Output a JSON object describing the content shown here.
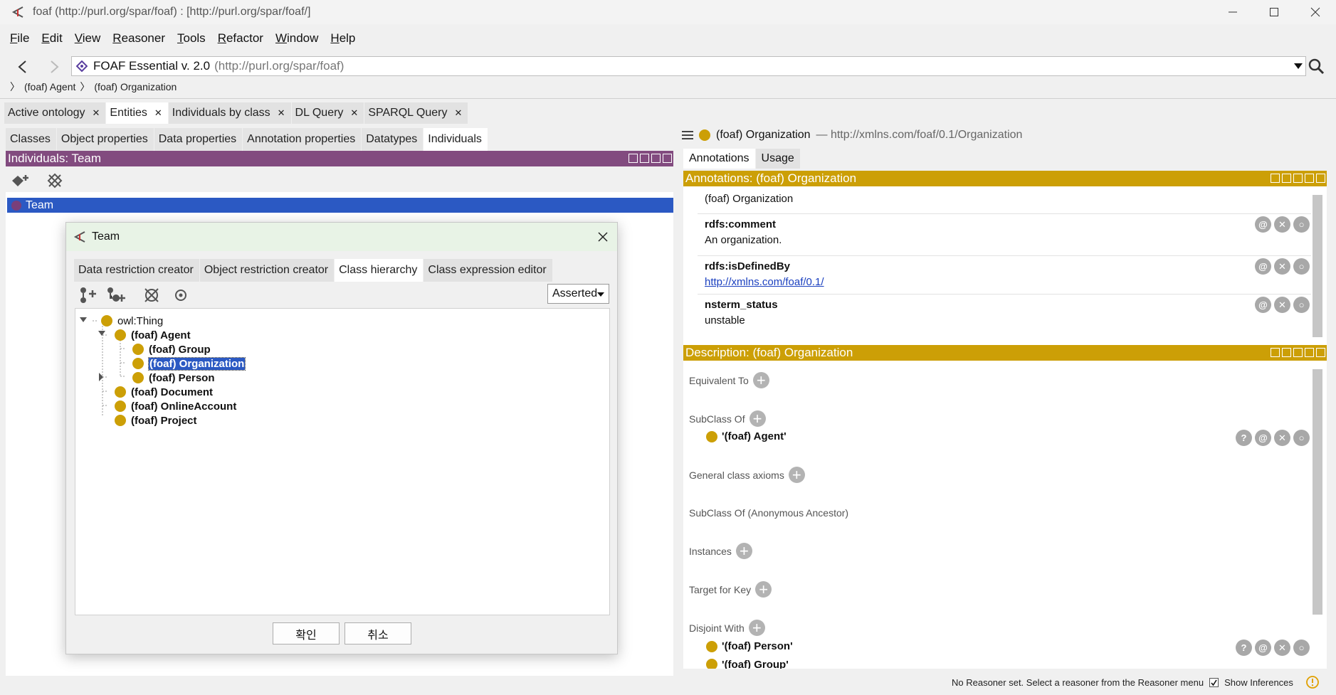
{
  "window": {
    "title": "foaf (http://purl.org/spar/foaf)  : [http://purl.org/spar/foaf/]"
  },
  "menu": [
    "File",
    "Edit",
    "View",
    "Reasoner",
    "Tools",
    "Refactor",
    "Window",
    "Help"
  ],
  "address": {
    "name": "FOAF Essential v. 2.0",
    "iri": "(http://purl.org/spar/foaf)"
  },
  "breadcrumb": [
    "(foaf) Agent",
    "(foaf) Organization"
  ],
  "main_tabs": [
    "Active ontology",
    "Entities",
    "Individuals by class",
    "DL Query",
    "SPARQL Query"
  ],
  "sub_tabs": [
    "Classes",
    "Object properties",
    "Data properties",
    "Annotation properties",
    "Datatypes",
    "Individuals"
  ],
  "left_panel": {
    "title": "Individuals: Team",
    "selected_individual": "Team"
  },
  "entity": {
    "name": "(foaf) Organization",
    "iri": "— http://xmlns.com/foaf/0.1/Organization"
  },
  "right_tabs": [
    "Annotations",
    "Usage"
  ],
  "annotations": {
    "title": "Annotations: (foaf) Organization",
    "label_value": "(foaf) Organization",
    "items": [
      {
        "prop": "rdfs:comment",
        "value": "An organization."
      },
      {
        "prop": "rdfs:isDefinedBy",
        "value": "http://xmlns.com/foaf/0.1/"
      },
      {
        "prop": "nsterm_status",
        "value": "unstable"
      }
    ]
  },
  "description": {
    "title": "Description: (foaf) Organization",
    "sections": [
      "Equivalent To",
      "SubClass Of",
      "General class axioms",
      "SubClass Of (Anonymous Ancestor)",
      "Instances",
      "Target for Key",
      "Disjoint With"
    ],
    "subclass_of": [
      "'(foaf) Agent'"
    ],
    "disjoint_with": [
      "'(foaf) Person'",
      "'(foaf) Group'"
    ]
  },
  "status": {
    "message": "No Reasoner set. Select a reasoner from the Reasoner menu",
    "show_inferences": "Show Inferences"
  },
  "dialog": {
    "title": "Team",
    "tabs": [
      "Data restriction creator",
      "Object restriction creator",
      "Class hierarchy",
      "Class expression editor"
    ],
    "mode": "Asserted",
    "tree": {
      "root": "owl:Thing",
      "agent": "(foaf) Agent",
      "group": "(foaf) Group",
      "organization": "(foaf) Organization",
      "person": "(foaf) Person",
      "document": "(foaf) Document",
      "online_account": "(foaf) OnlineAccount",
      "project": "(foaf) Project"
    },
    "ok": "확인",
    "cancel": "취소"
  },
  "colors": {
    "individuals_header": "#824b7f",
    "ontology_header": "#cc9f06",
    "selection": "#2b59c3",
    "class_dot": "#cc9f06"
  }
}
